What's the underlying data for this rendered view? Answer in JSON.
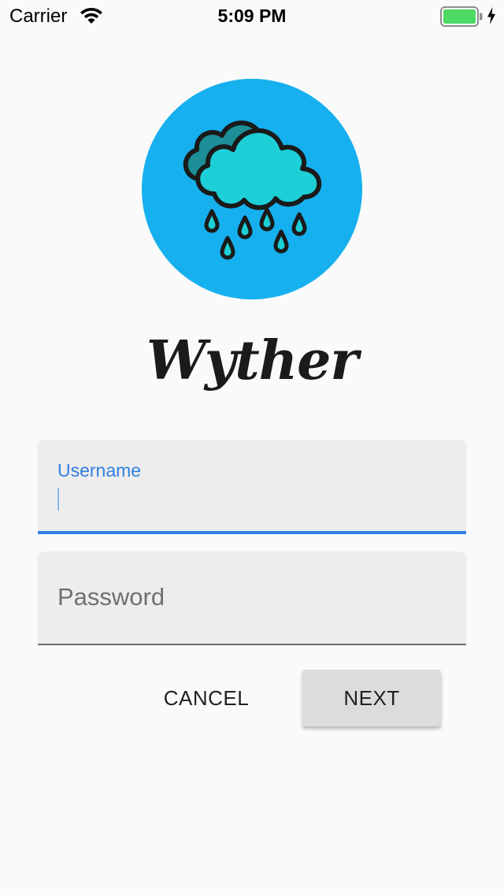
{
  "status_bar": {
    "carrier": "Carrier",
    "time": "5:09 PM",
    "wifi_icon": "wifi-icon",
    "battery_icon": "battery-icon",
    "charging_icon": "charging-bolt-icon",
    "battery_color": "#4cd964"
  },
  "logo": {
    "icon": "rain-cloud-icon",
    "circle_color": "#16b0ef",
    "cloud_color": "#1dcfd6"
  },
  "app_name": "Wyther",
  "form": {
    "username": {
      "label": "Username",
      "value": "",
      "focused": true,
      "accent_color": "#2f7fe0"
    },
    "password": {
      "placeholder": "Password",
      "value": ""
    }
  },
  "actions": {
    "cancel_label": "CANCEL",
    "next_label": "NEXT"
  }
}
